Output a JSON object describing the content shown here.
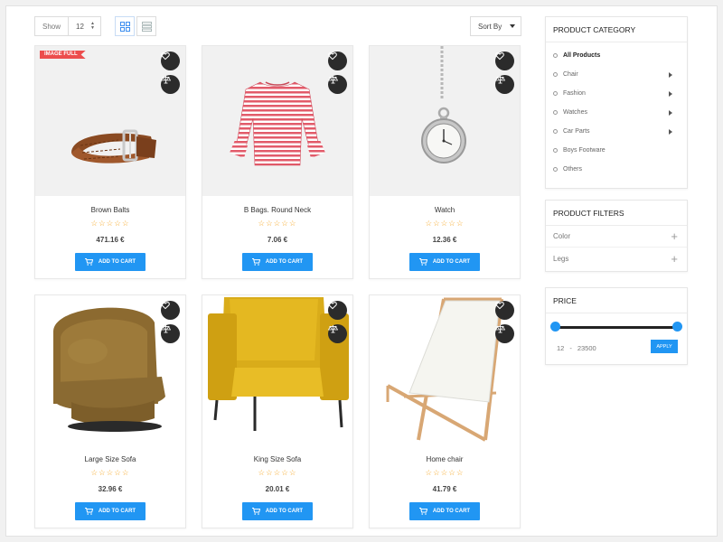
{
  "toolbar": {
    "show_label": "Show",
    "show_value": "12",
    "sort_label": "Sort By"
  },
  "products": [
    {
      "name": "Brown Balts",
      "price": "471.16 €",
      "badge": "IMAGE FULL",
      "stars": "☆☆☆☆☆",
      "cart": "ADD TO CART"
    },
    {
      "name": "B Bags. Round Neck",
      "price": "7.06 €",
      "stars": "☆☆☆☆☆",
      "cart": "ADD TO CART"
    },
    {
      "name": "Watch",
      "price": "12.36 €",
      "stars": "☆☆☆☆☆",
      "cart": "ADD TO CART"
    },
    {
      "name": "Large Size Sofa",
      "price": "32.96 €",
      "stars": "☆☆☆☆☆",
      "cart": "ADD TO CART"
    },
    {
      "name": "King Size Sofa",
      "price": "20.01 €",
      "stars": "☆☆☆☆☆",
      "cart": "ADD TO CART"
    },
    {
      "name": "Home chair",
      "price": "41.79 €",
      "stars": "☆☆☆☆☆",
      "cart": "ADD TO CART"
    }
  ],
  "sidebar": {
    "category": {
      "title": "PRODUCT CATEGORY",
      "items": [
        {
          "label": "All Products"
        },
        {
          "label": "Chair"
        },
        {
          "label": "Fashion"
        },
        {
          "label": "Watches"
        },
        {
          "label": "Car Parts"
        },
        {
          "label": "Boys Footware"
        },
        {
          "label": "Others"
        }
      ]
    },
    "filters": {
      "title": "PRODUCT FILTERS",
      "items": [
        {
          "label": "Color"
        },
        {
          "label": "Legs"
        }
      ]
    },
    "price": {
      "title": "PRICE",
      "min": "12",
      "separator": "-",
      "max": "23500",
      "apply": "APPLY"
    }
  },
  "colors": {
    "accent": "#2196f3",
    "star": "#f6a623",
    "badge": "#ec4d4d",
    "round_button": "#2b2b2b"
  }
}
